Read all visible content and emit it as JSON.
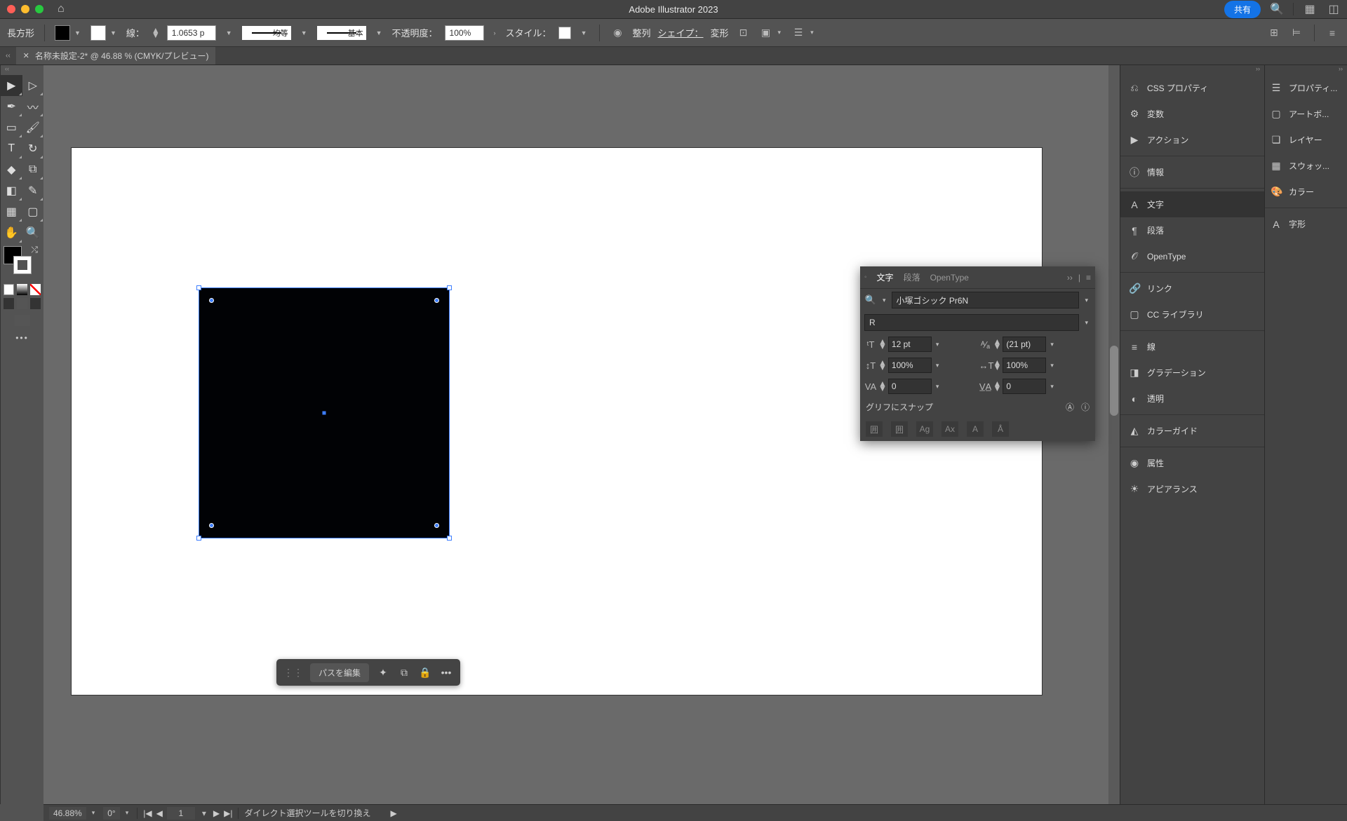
{
  "titlebar": {
    "app_title": "Adobe Illustrator 2023",
    "share": "共有"
  },
  "controlbar": {
    "shape_label": "長方形",
    "stroke_label": "線：",
    "stroke_width": "1.0653 p",
    "stroke_profile": "均等",
    "stroke_style": "基本",
    "opacity_label": "不透明度：",
    "opacity_value": "100%",
    "style_label": "スタイル：",
    "align": "整列",
    "shape": "シェイプ：",
    "transform": "変形"
  },
  "doctab": {
    "name": "名称未設定-2* @ 46.88 % (CMYK/プレビュー)"
  },
  "context_toolbar": {
    "edit_path": "パスを編集"
  },
  "char_panel": {
    "tabs": {
      "char": "文字",
      "para": "段落",
      "opentype": "OpenType"
    },
    "font_family": "小塚ゴシック Pr6N",
    "font_style": "R",
    "font_size": "12 pt",
    "leading": "(21 pt)",
    "hscale": "100%",
    "vscale": "100%",
    "tracking": "0",
    "kerning": "0",
    "snap_label": "グリフにスナップ"
  },
  "right_panel_1": {
    "items": [
      "CSS プロパティ",
      "変数",
      "アクション",
      "情報",
      "文字",
      "段落",
      "OpenType",
      "リンク",
      "CC ライブラリ",
      "線",
      "グラデーション",
      "透明",
      "カラーガイド",
      "属性",
      "アピアランス"
    ]
  },
  "right_panel_2": {
    "items": [
      "プロパティ...",
      "アートボ...",
      "レイヤー",
      "スウォッ...",
      "カラー",
      "字形"
    ]
  },
  "statusbar": {
    "zoom": "46.88%",
    "rotation": "0°",
    "artboard": "1",
    "hint": "ダイレクト選択ツールを切り換え"
  }
}
